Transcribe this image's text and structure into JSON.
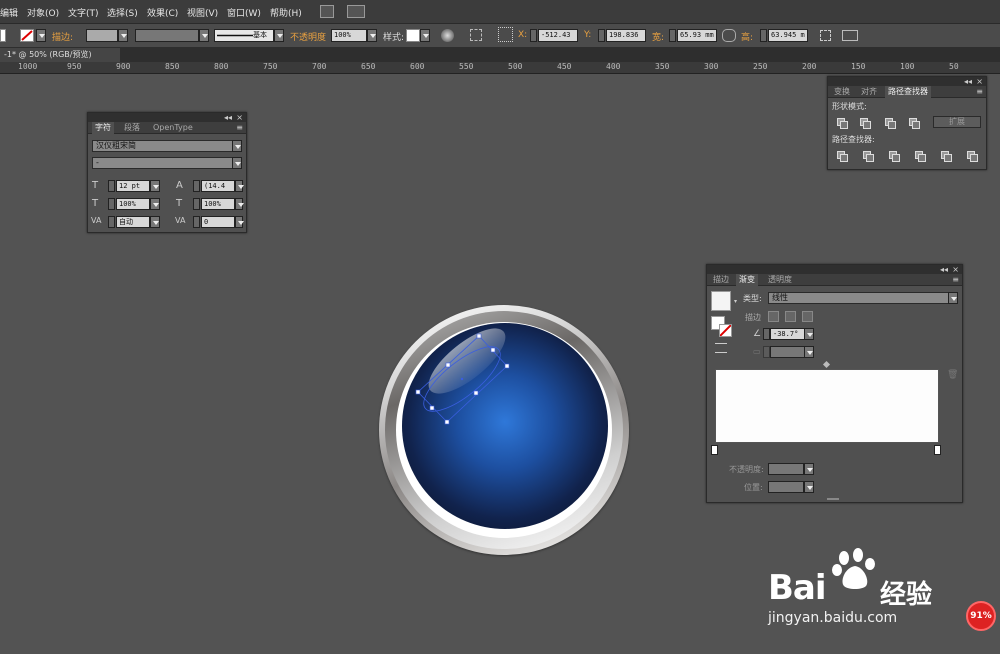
{
  "menu": {
    "items": [
      "编辑",
      "对象(O)",
      "文字(T)",
      "选择(S)",
      "效果(C)",
      "视图(V)",
      "窗口(W)",
      "帮助(H)"
    ]
  },
  "control": {
    "stroke_label": "描边:",
    "stroke_style": "基本",
    "opacity_label": "不透明度",
    "opacity_value": "100%",
    "style_label": "样式:",
    "x_label": "X:",
    "x_value": "-512.43",
    "y_label": "Y:",
    "y_value": "198.836",
    "w_label": "宽:",
    "w_value": "65.93 mm",
    "h_label": "高:",
    "h_value": "63.945 m"
  },
  "doc": {
    "tab": "-1* @ 50% (RGB/预览)"
  },
  "ruler": {
    "labels": [
      "1000",
      "950",
      "900",
      "850",
      "800",
      "750",
      "700",
      "650",
      "600",
      "550",
      "500",
      "450",
      "400",
      "350",
      "300",
      "250",
      "200",
      "150",
      "100",
      "50"
    ]
  },
  "char_panel": {
    "tabs": [
      "字符",
      "段落",
      "OpenType"
    ],
    "font": "汉仪粗宋简",
    "style": "-",
    "size": "12 pt",
    "leading": "(14.4",
    "hscale": "100%",
    "vscale": "100%",
    "kerning": "自动",
    "tracking": "0"
  },
  "path_panel": {
    "tabs": [
      "变换",
      "对齐",
      "路径查找器"
    ],
    "shape_modes": "形状模式:",
    "expand": "扩展",
    "pathfinders": "路径查找器:"
  },
  "grad_panel": {
    "tabs": [
      "描边",
      "渐变",
      "透明度"
    ],
    "type_label": "类型:",
    "type_value": "线性",
    "stroke_label": "描边",
    "angle": "-38.7°",
    "opacity_label": "不透明度:",
    "location_label": "位置:"
  },
  "watermark": {
    "logo": "Bai",
    "logo2": "经验",
    "url": "jingyan.baidu.com"
  },
  "badge": "91%",
  "colors": {
    "accent": "#1f5bbf",
    "ui_bg": "#535353"
  }
}
